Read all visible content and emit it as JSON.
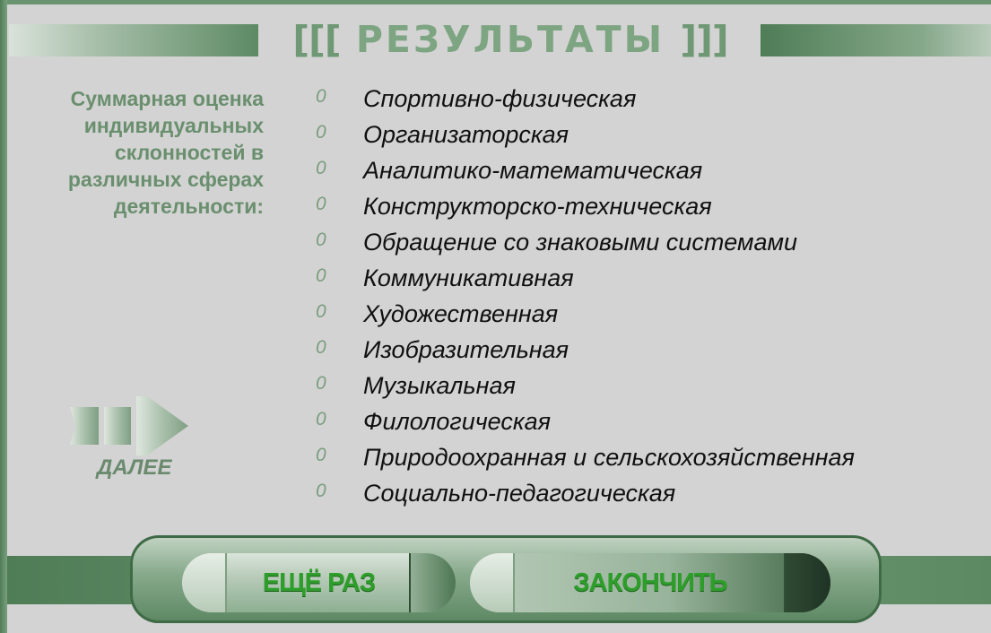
{
  "header": {
    "title": "РЕЗУЛЬТАТЫ",
    "bracket_open": "[[[",
    "bracket_close": "]]]"
  },
  "caption": {
    "lines": [
      "Суммарная оценка",
      "индивидуальных",
      "склонностей в",
      "различных сферах",
      "деятельности:"
    ]
  },
  "results": [
    {
      "score": "0",
      "label": "Спортивно-физическая"
    },
    {
      "score": "0",
      "label": "Организаторская"
    },
    {
      "score": "0",
      "label": "Аналитико-математическая"
    },
    {
      "score": "0",
      "label": "Конструкторско-техническая"
    },
    {
      "score": "0",
      "label": "Обращение со знаковыми системами"
    },
    {
      "score": "0",
      "label": "Коммуникативная"
    },
    {
      "score": "0",
      "label": "Художественная"
    },
    {
      "score": "0",
      "label": "Изобразительная"
    },
    {
      "score": "0",
      "label": "Музыкальная"
    },
    {
      "score": "0",
      "label": "Филологическая"
    },
    {
      "score": "0",
      "label": "Природоохранная и сельскохозяйственная"
    },
    {
      "score": "0",
      "label": "Социально-педагогическая"
    }
  ],
  "nav": {
    "next_label": "ДАЛЕЕ",
    "next_icon": "arrow-right-icon"
  },
  "actions": {
    "again_label": "ЕЩЁ РАЗ",
    "finish_label": "ЗАКОНЧИТЬ"
  },
  "colors": {
    "background": "#d3d3d3",
    "accent_green": "#6a9470",
    "title_green": "#7ea582",
    "button_text": "#2e9e2b"
  }
}
